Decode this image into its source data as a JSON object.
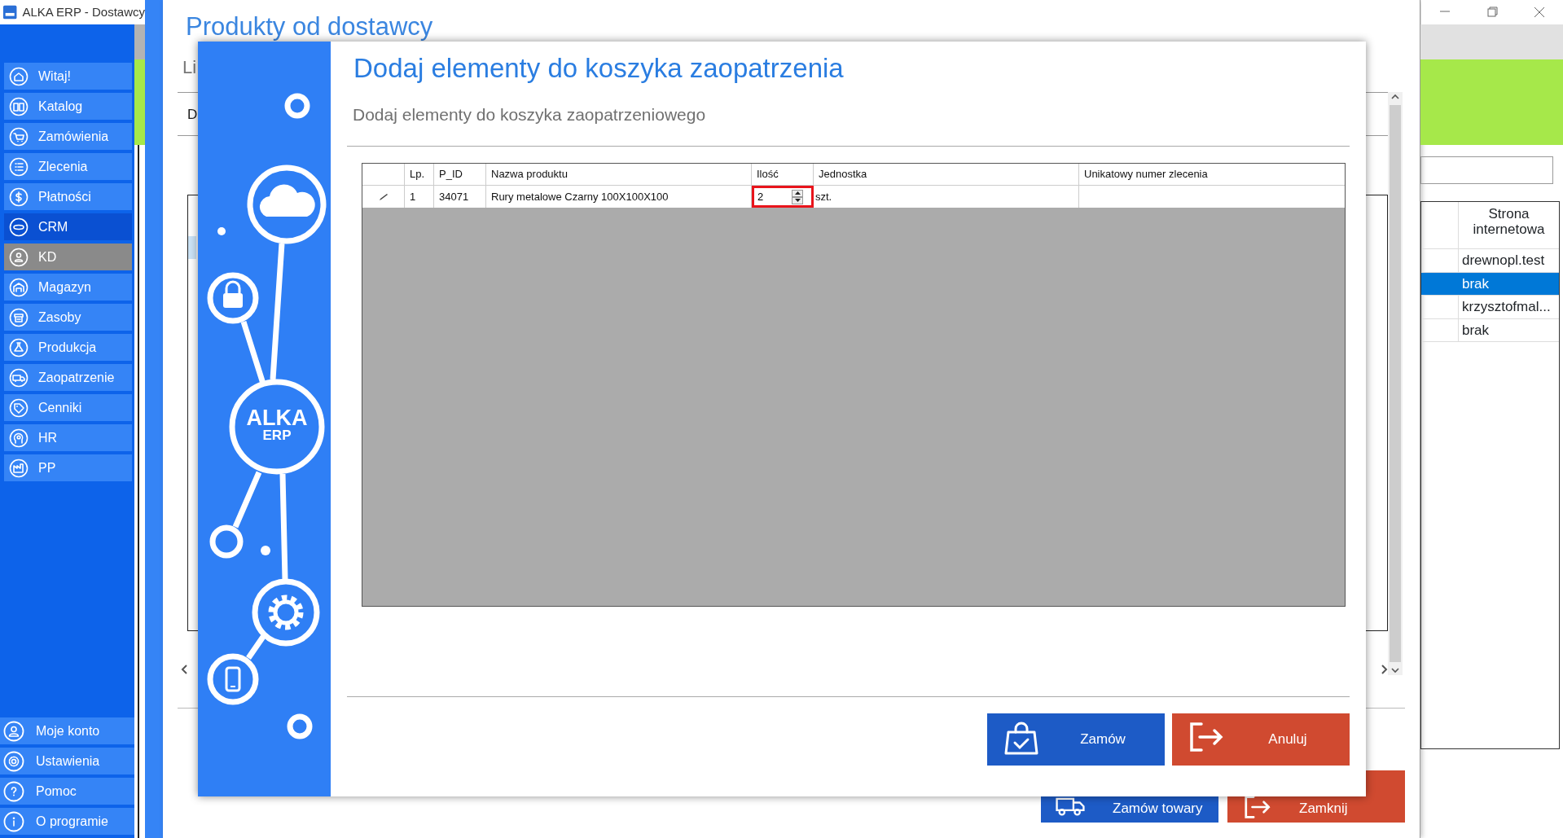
{
  "window": {
    "title": "ALKA ERP - Dostawcy"
  },
  "sidebar": {
    "items": [
      {
        "label": "Witaj!",
        "selected": false,
        "hovered": false
      },
      {
        "label": "Katalog",
        "selected": false,
        "hovered": false
      },
      {
        "label": "Zamówienia",
        "selected": false,
        "hovered": false
      },
      {
        "label": "Zlecenia",
        "selected": false,
        "hovered": false
      },
      {
        "label": "Płatności",
        "selected": false,
        "hovered": false
      },
      {
        "label": "CRM",
        "selected": true,
        "hovered": false
      },
      {
        "label": "KD",
        "selected": false,
        "hovered": true
      },
      {
        "label": "Magazyn",
        "selected": false,
        "hovered": false
      },
      {
        "label": "Zasoby",
        "selected": false,
        "hovered": false
      },
      {
        "label": "Produkcja",
        "selected": false,
        "hovered": false
      },
      {
        "label": "Zaopatrzenie",
        "selected": false,
        "hovered": false
      },
      {
        "label": "Cenniki",
        "selected": false,
        "hovered": false
      },
      {
        "label": "HR",
        "selected": false,
        "hovered": false
      },
      {
        "label": "PP",
        "selected": false,
        "hovered": false
      }
    ],
    "bottom_items": [
      {
        "label": "Moje konto"
      },
      {
        "label": "Ustawienia"
      },
      {
        "label": "Pomoc"
      },
      {
        "label": "O programie"
      }
    ]
  },
  "background_window": {
    "title": "Produkty od dostawcy",
    "subtitle": "Li",
    "filter_label": "D",
    "buttons": [
      {
        "label": "Zamów towary",
        "kind": "primary"
      },
      {
        "label": "Zamknij",
        "kind": "danger"
      }
    ]
  },
  "side_table": {
    "columns": [
      "Strona internetowa"
    ],
    "rows": [
      {
        "website": "drewnopl.test",
        "selected": false
      },
      {
        "website": "brak",
        "selected": true
      },
      {
        "website": "krzysztofmal...",
        "selected": false
      },
      {
        "website": "brak",
        "selected": false
      }
    ]
  },
  "dialog": {
    "title": "Dodaj elementy do koszyka zaopatrzenia",
    "subtitle": "Dodaj elementy do koszyka zaopatrzeniowego",
    "logo": [
      "ALKA",
      "ERP"
    ],
    "grid": {
      "columns": [
        "Lp.",
        "P_ID",
        "Nazwa produktu",
        "Ilość",
        "Jednostka",
        "Unikatowy numer zlecenia"
      ],
      "rows": [
        {
          "lp": "1",
          "p_id": "34071",
          "name": "Rury metalowe Czarny 100X100X100",
          "quantity": "2",
          "unit": "szt.",
          "editing": true,
          "quantity_highlighted": true
        }
      ]
    },
    "buttons": [
      {
        "label": "Zamów",
        "kind": "primary"
      },
      {
        "label": "Anuluj",
        "kind": "danger"
      }
    ]
  }
}
